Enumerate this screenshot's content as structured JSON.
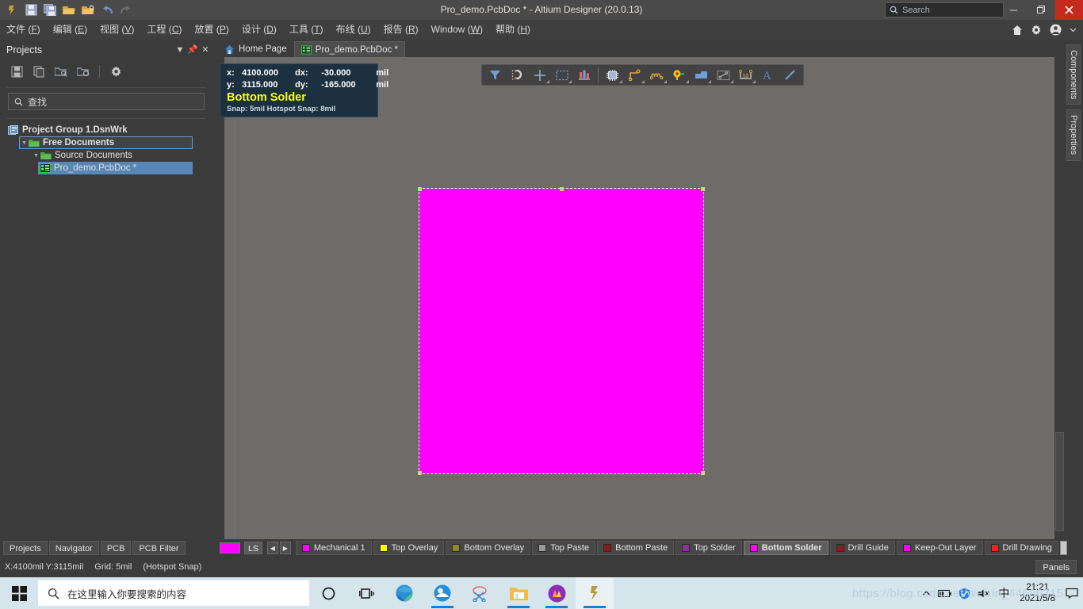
{
  "window": {
    "title": "Pro_demo.PcbDoc * - Altium Designer (20.0.13)",
    "search_placeholder": "Search",
    "minimize": "–",
    "maximize": "❐",
    "close": "✕"
  },
  "quick_access": [
    {
      "name": "altium-logo-icon",
      "label": "A"
    },
    {
      "name": "save-icon",
      "label": "Save"
    },
    {
      "name": "save-all-icon",
      "label": "Save All"
    },
    {
      "name": "open-icon",
      "label": "Open"
    },
    {
      "name": "open-project-icon",
      "label": "Open Project"
    },
    {
      "name": "undo-icon",
      "label": "Undo"
    },
    {
      "name": "redo-icon",
      "label": "Redo"
    }
  ],
  "menu": {
    "items": [
      {
        "text": "文件",
        "accel": "F"
      },
      {
        "text": "编辑",
        "accel": "E"
      },
      {
        "text": "视图",
        "accel": "V"
      },
      {
        "text": "工程",
        "accel": "C"
      },
      {
        "text": "放置",
        "accel": "P"
      },
      {
        "text": "设计",
        "accel": "D"
      },
      {
        "text": "工具",
        "accel": "T"
      },
      {
        "text": "布线",
        "accel": "U"
      },
      {
        "text": "报告",
        "accel": "R"
      },
      {
        "text": "Window",
        "accel": "W"
      },
      {
        "text": "帮助",
        "accel": "H"
      }
    ],
    "right_icons": [
      "home-icon",
      "settings-gear-icon",
      "user-account-icon",
      "chevron-down-icon"
    ]
  },
  "projects_panel": {
    "title": "Projects",
    "header_buttons": [
      "dropdown-chevron-icon",
      "pin-icon",
      "close-icon"
    ],
    "toolbar_icons": [
      "save-icon",
      "copy-icon",
      "open-project-folder-icon",
      "close-project-folder-icon",
      "settings-gear-icon"
    ],
    "search_placeholder": "查找",
    "tree": [
      {
        "label": "Project Group 1.DsnWrk",
        "icon": "project-group-icon",
        "depth": 0,
        "state": "normal"
      },
      {
        "label": "Free Documents",
        "icon": "folder-icon",
        "depth": 1,
        "state": "focused"
      },
      {
        "label": "Source Documents",
        "icon": "folder-icon",
        "depth": 2,
        "state": "normal"
      },
      {
        "label": "Pro_demo.PcbDoc *",
        "icon": "pcb-doc-icon",
        "depth": 3,
        "state": "selected"
      }
    ],
    "bottom_tabs": [
      "Projects",
      "Navigator",
      "PCB",
      "PCB Filter"
    ]
  },
  "document_tabs": [
    {
      "label": "Home Page",
      "icon": "home-icon",
      "active": false
    },
    {
      "label": "Pro_demo.PcbDoc *",
      "icon": "pcb-doc-icon",
      "active": true
    }
  ],
  "hud": {
    "x_label": "x:",
    "x_value": "4100.000",
    "dx_label": "dx:",
    "dx_value": "-30.000",
    "dx_unit": "mil",
    "y_label": "y:",
    "y_value": "3115.000",
    "dy_label": "dy:",
    "dy_value": "-165.000",
    "dy_unit": "mil",
    "layer": "Bottom Solder",
    "snap": "Snap: 5mil Hotspot Snap: 8mil",
    "layer_color": "#ffff00"
  },
  "float_toolbar": [
    {
      "name": "filter-icon",
      "has_dropdown": false
    },
    {
      "name": "magnet-snap-icon",
      "has_dropdown": false
    },
    {
      "name": "crosshair-place-icon",
      "has_dropdown": true
    },
    {
      "name": "selection-rectangle-icon",
      "has_dropdown": true
    },
    {
      "name": "align-distribute-icon",
      "has_dropdown": false
    },
    {
      "name": "place-component-icon",
      "has_dropdown": true
    },
    {
      "name": "route-track-icon",
      "has_dropdown": true
    },
    {
      "name": "interactive-length-tuning-icon",
      "has_dropdown": true
    },
    {
      "name": "place-via-pad-icon",
      "has_dropdown": true
    },
    {
      "name": "place-polygon-icon",
      "has_dropdown": true
    },
    {
      "name": "measure-distance-icon",
      "has_dropdown": true
    },
    {
      "name": "place-dimension-icon",
      "has_dropdown": true
    },
    {
      "name": "place-string-icon",
      "has_dropdown": false
    },
    {
      "name": "place-line-icon",
      "has_dropdown": false
    }
  ],
  "canvas": {
    "selection_color": "#ff00ff",
    "background": "#6e6b68",
    "selection_border": "#f2f2f2"
  },
  "right_dock_tabs": [
    "Components",
    "Properties"
  ],
  "layer_bar": {
    "active_swatch_color": "#ff00ff",
    "ls_label": "LS",
    "prev_label": "◀",
    "next_label": "▶",
    "layers": [
      {
        "label": "Mechanical 1",
        "color": "#ff00ff",
        "active": false
      },
      {
        "label": "Top Overlay",
        "color": "#ffff00",
        "active": false
      },
      {
        "label": "Bottom Overlay",
        "color": "#8b8b1e",
        "active": false
      },
      {
        "label": "Top Paste",
        "color": "#9a9a9a",
        "active": false
      },
      {
        "label": "Bottom Paste",
        "color": "#8b1a1a",
        "active": false
      },
      {
        "label": "Top Solder",
        "color": "#8b2fa0",
        "active": false
      },
      {
        "label": "Bottom Solder",
        "color": "#ff00ff",
        "active": true
      },
      {
        "label": "Drill Guide",
        "color": "#8b1a1a",
        "active": false
      },
      {
        "label": "Keep-Out Layer",
        "color": "#ff00ff",
        "active": false
      },
      {
        "label": "Drill Drawing",
        "color": "#ff2020",
        "active": false
      }
    ]
  },
  "status_bar": {
    "coords": "X:4100mil Y:3115mil",
    "grid": "Grid: 5mil",
    "snap_mode": "(Hotspot Snap)",
    "panels_button": "Panels"
  },
  "taskbar": {
    "start_icon": "windows-start-icon",
    "search_placeholder": "在这里输入你要搜索的内容",
    "apps": [
      {
        "name": "cortana-icon"
      },
      {
        "name": "task-view-icon"
      },
      {
        "name": "microsoft-edge-icon"
      },
      {
        "name": "qq-browser-icon"
      },
      {
        "name": "snipping-tool-icon"
      },
      {
        "name": "file-explorer-icon"
      },
      {
        "name": "app-purple-icon"
      },
      {
        "name": "altium-designer-icon"
      }
    ],
    "tray": [
      "show-hidden-icons-chevron",
      "battery-icon",
      "security-shield-icon",
      "volume-muted-icon",
      "ime-chinese-icon"
    ],
    "clock_time": "21:21",
    "clock_date": "2021/5/8",
    "action_center": "notification-icon"
  },
  "watermark": "https://blog.csdn.net/weixin_44606315"
}
